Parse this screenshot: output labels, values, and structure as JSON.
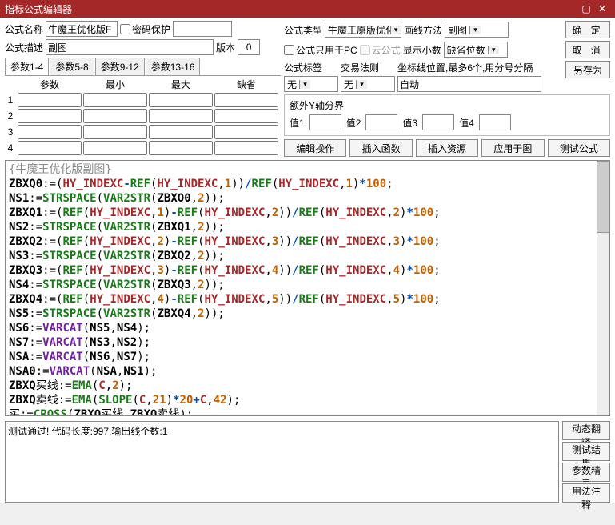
{
  "window": {
    "title": "指标公式编辑器"
  },
  "left": {
    "name_lbl": "公式名称",
    "name_val": "牛魔王优化版F",
    "pw_lbl": "密码保护",
    "desc_lbl": "公式描述",
    "desc_val": "副图",
    "ver_lbl": "版本",
    "ver_val": "0",
    "tabs": [
      "参数1-4",
      "参数5-8",
      "参数9-12",
      "参数13-16"
    ],
    "param_hd": [
      "参数",
      "最小",
      "最大",
      "缺省"
    ],
    "rows": [
      "1",
      "2",
      "3",
      "4"
    ]
  },
  "right": {
    "type_lbl": "公式类型",
    "type_val": "牛魔王原版优化",
    "draw_lbl": "画线方法",
    "draw_val": "副图",
    "pc_lbl": "公式只用于PC",
    "cloud_lbl": "云公式",
    "dec_lbl": "显示小数",
    "dec_val": "缺省位数",
    "tag_lbl": "公式标签",
    "tag_val": "无",
    "rule_lbl": "交易法则",
    "rule_val": "无",
    "coord_lbl": "坐标线位置,最多6个,用分号分隔",
    "coord_val": "自动",
    "yaxis_lbl": "额外Y轴分界",
    "vals": [
      "值1",
      "值2",
      "值3",
      "值4"
    ],
    "ok": "确 定",
    "cancel": "取 消",
    "saveas": "另存为",
    "b1": "编辑操作",
    "b2": "插入函数",
    "b3": "插入资源",
    "b4": "应用于图",
    "b5": "测试公式"
  },
  "code_title": "{牛魔王优化版副图}",
  "status": "测试通过! 代码长度:997,输出线个数:1",
  "side": {
    "s1": "动态翻译",
    "s2": "测试结果",
    "s3": "参数精灵",
    "s4": "用法注释"
  }
}
